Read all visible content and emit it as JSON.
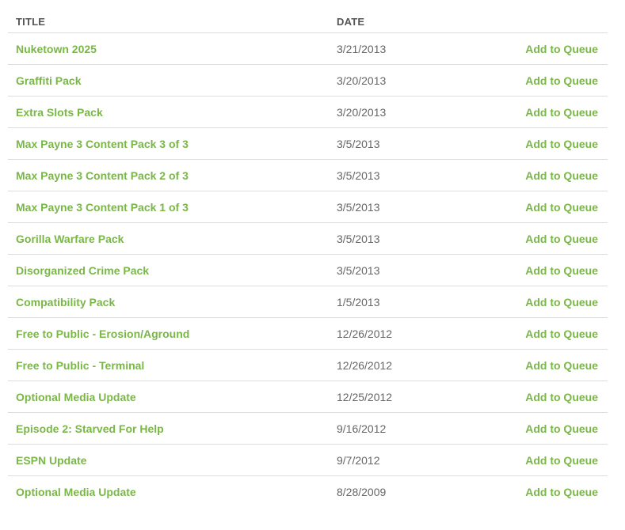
{
  "header": {
    "title_label": "TITLE",
    "date_label": "DATE"
  },
  "colors": {
    "accent": "#7ab648",
    "date_text": "#666666",
    "header_text": "#555555",
    "divider": "#dddddd"
  },
  "rows": [
    {
      "title": "Nuketown 2025",
      "date": "3/21/2013",
      "action": "Add to Queue"
    },
    {
      "title": "Graffiti Pack",
      "date": "3/20/2013",
      "action": "Add to Queue"
    },
    {
      "title": "Extra Slots Pack",
      "date": "3/20/2013",
      "action": "Add to Queue"
    },
    {
      "title": "Max Payne 3 Content Pack 3 of 3",
      "date": "3/5/2013",
      "action": "Add to Queue"
    },
    {
      "title": "Max Payne 3 Content Pack 2 of 3",
      "date": "3/5/2013",
      "action": "Add to Queue"
    },
    {
      "title": "Max Payne 3 Content Pack 1 of 3",
      "date": "3/5/2013",
      "action": "Add to Queue"
    },
    {
      "title": "Gorilla Warfare Pack",
      "date": "3/5/2013",
      "action": "Add to Queue"
    },
    {
      "title": "Disorganized Crime Pack",
      "date": "3/5/2013",
      "action": "Add to Queue"
    },
    {
      "title": "Compatibility Pack",
      "date": "1/5/2013",
      "action": "Add to Queue"
    },
    {
      "title": "Free to Public - Erosion/Aground",
      "date": "12/26/2012",
      "action": "Add to Queue"
    },
    {
      "title": "Free to Public - Terminal",
      "date": "12/26/2012",
      "action": "Add to Queue"
    },
    {
      "title": "Optional Media Update",
      "date": "12/25/2012",
      "action": "Add to Queue"
    },
    {
      "title": "Episode 2: Starved For Help",
      "date": "9/16/2012",
      "action": "Add to Queue"
    },
    {
      "title": "ESPN Update",
      "date": "9/7/2012",
      "action": "Add to Queue"
    },
    {
      "title": "Optional Media Update",
      "date": "8/28/2009",
      "action": "Add to Queue"
    }
  ]
}
